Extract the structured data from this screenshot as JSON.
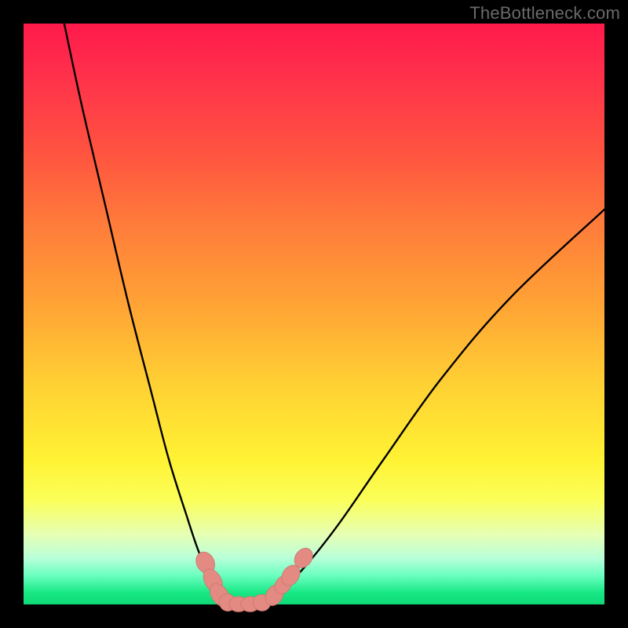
{
  "watermark": "TheBottleneck.com",
  "colors": {
    "frame": "#000000",
    "gradient_top": "#ff1a4b",
    "gradient_mid": "#ffd033",
    "gradient_bottom": "#0fd877",
    "curve": "#000000",
    "markers_fill": "#e38b83",
    "markers_stroke": "#d07a72"
  },
  "chart_data": {
    "type": "line",
    "title": "",
    "xlabel": "",
    "ylabel": "",
    "xlim": [
      0,
      100
    ],
    "ylim": [
      0,
      100
    ],
    "grid": false,
    "legend": false,
    "series": [
      {
        "name": "left-branch",
        "x": [
          7,
          10,
          14,
          18,
          22,
          25,
          28,
          30,
          32,
          33.5,
          34.5
        ],
        "y": [
          100,
          86,
          69,
          52,
          36.5,
          25,
          15.5,
          9.5,
          4.8,
          2,
          0.8
        ]
      },
      {
        "name": "valley",
        "x": [
          34.5,
          36,
          38,
          40,
          42
        ],
        "y": [
          0.8,
          0.2,
          0,
          0.2,
          0.8
        ]
      },
      {
        "name": "right-branch",
        "x": [
          42,
          44,
          48,
          54,
          62,
          72,
          84,
          100
        ],
        "y": [
          0.8,
          2.2,
          6,
          13.5,
          25,
          39,
          53,
          68
        ]
      }
    ],
    "markers": [
      {
        "cx": 31.3,
        "cy": 7.2,
        "rx": 1.5,
        "ry": 1.9,
        "rot": -28
      },
      {
        "cx": 32.6,
        "cy": 4.1,
        "rx": 1.4,
        "ry": 2.2,
        "rot": -30
      },
      {
        "cx": 33.8,
        "cy": 1.6,
        "rx": 1.4,
        "ry": 2.2,
        "rot": -35
      },
      {
        "cx": 35.1,
        "cy": 0.35,
        "rx": 1.4,
        "ry": 1.5,
        "rot": -20
      },
      {
        "cx": 37.0,
        "cy": 0.05,
        "rx": 1.6,
        "ry": 1.3,
        "rot": 0
      },
      {
        "cx": 39.0,
        "cy": 0.05,
        "rx": 1.6,
        "ry": 1.3,
        "rot": 0
      },
      {
        "cx": 41.0,
        "cy": 0.3,
        "rx": 1.5,
        "ry": 1.4,
        "rot": 15
      },
      {
        "cx": 43.2,
        "cy": 1.6,
        "rx": 1.4,
        "ry": 1.9,
        "rot": 32
      },
      {
        "cx": 44.7,
        "cy": 3.4,
        "rx": 1.3,
        "ry": 1.7,
        "rot": 34
      },
      {
        "cx": 46.0,
        "cy": 5.0,
        "rx": 1.4,
        "ry": 1.9,
        "rot": 34
      },
      {
        "cx": 48.2,
        "cy": 8.0,
        "rx": 1.4,
        "ry": 1.8,
        "rot": 36
      }
    ]
  }
}
